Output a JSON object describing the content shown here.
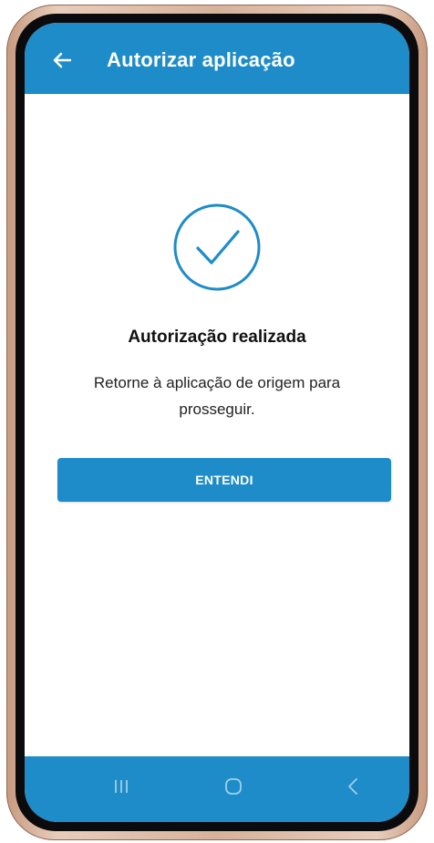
{
  "appbar": {
    "title": "Autorizar aplicação",
    "back_icon": "arrow-left-icon"
  },
  "content": {
    "status_icon": "check-circle-icon",
    "title": "Autorização realizada",
    "message": "Retorne à aplicação de origem para prosseguir.",
    "button_label": "ENTENDI"
  },
  "navbar": {
    "recents_icon": "recents-icon",
    "home_icon": "home-icon",
    "back_icon": "back-chevron-icon"
  },
  "colors": {
    "primary": "#1e8cc8",
    "text": "#111111",
    "background": "#ffffff"
  }
}
